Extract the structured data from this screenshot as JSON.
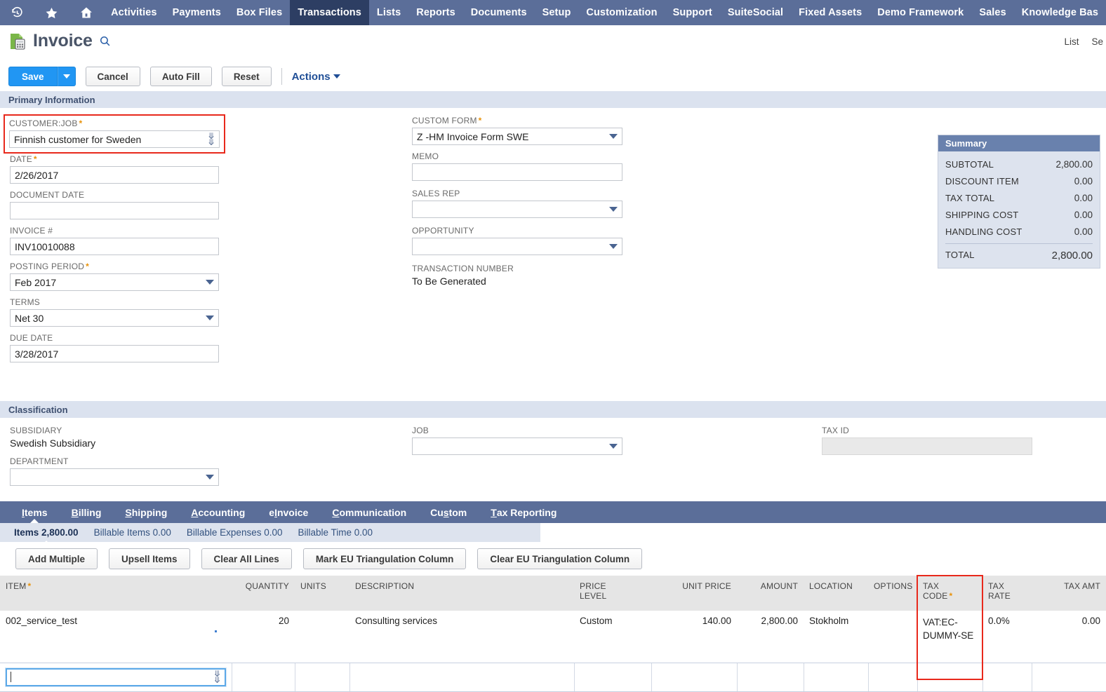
{
  "topnav": {
    "icons": [
      {
        "name": "recent-records-icon",
        "glyph": "↺"
      },
      {
        "name": "favorites-star-icon",
        "glyph": "★"
      },
      {
        "name": "home-icon",
        "glyph": "⌂"
      }
    ],
    "items": [
      {
        "label": "Activities",
        "active": false
      },
      {
        "label": "Payments",
        "active": false
      },
      {
        "label": "Box Files",
        "active": false
      },
      {
        "label": "Transactions",
        "active": true
      },
      {
        "label": "Lists",
        "active": false
      },
      {
        "label": "Reports",
        "active": false
      },
      {
        "label": "Documents",
        "active": false
      },
      {
        "label": "Setup",
        "active": false
      },
      {
        "label": "Customization",
        "active": false
      },
      {
        "label": "Support",
        "active": false
      },
      {
        "label": "SuiteSocial",
        "active": false
      },
      {
        "label": "Fixed Assets",
        "active": false
      },
      {
        "label": "Demo Framework",
        "active": false
      },
      {
        "label": "Sales",
        "active": false
      },
      {
        "label": "Knowledge Bas",
        "active": false
      }
    ]
  },
  "header": {
    "title": "Invoice",
    "right_links": [
      "List",
      "Se"
    ]
  },
  "toolbar": {
    "save_label": "Save",
    "cancel_label": "Cancel",
    "autofill_label": "Auto Fill",
    "reset_label": "Reset",
    "actions_label": "Actions"
  },
  "sections": {
    "primary_information": "Primary Information",
    "classification": "Classification"
  },
  "primary": {
    "customer_job": {
      "label": "CUSTOMER:JOB",
      "required": true,
      "value": "Finnish customer for Sweden",
      "highlighted": true
    },
    "date": {
      "label": "DATE",
      "required": true,
      "value": "2/26/2017"
    },
    "document_date": {
      "label": "DOCUMENT DATE",
      "required": false,
      "value": ""
    },
    "invoice_no": {
      "label": "INVOICE #",
      "required": false,
      "value": "INV10010088"
    },
    "posting_period": {
      "label": "POSTING PERIOD",
      "required": true,
      "value": "Feb 2017"
    },
    "terms": {
      "label": "TERMS",
      "required": false,
      "value": "Net 30"
    },
    "due_date": {
      "label": "DUE DATE",
      "required": false,
      "value": "3/28/2017"
    },
    "custom_form": {
      "label": "CUSTOM FORM",
      "required": true,
      "value": "Z -HM Invoice Form SWE"
    },
    "memo": {
      "label": "MEMO",
      "required": false,
      "value": ""
    },
    "sales_rep": {
      "label": "SALES REP",
      "required": false,
      "value": ""
    },
    "opportunity": {
      "label": "OPPORTUNITY",
      "required": false,
      "value": ""
    },
    "transaction_number": {
      "label": "TRANSACTION NUMBER",
      "value": "To Be Generated"
    }
  },
  "summary": {
    "title": "Summary",
    "rows": [
      {
        "label": "SUBTOTAL",
        "value": "2,800.00"
      },
      {
        "label": "DISCOUNT ITEM",
        "value": "0.00"
      },
      {
        "label": "TAX TOTAL",
        "value": "0.00"
      },
      {
        "label": "SHIPPING COST",
        "value": "0.00"
      },
      {
        "label": "HANDLING COST",
        "value": "0.00"
      }
    ],
    "total": {
      "label": "TOTAL",
      "value": "2,800.00"
    }
  },
  "classification": {
    "subsidiary": {
      "label": "SUBSIDIARY",
      "value": "Swedish Subsidiary"
    },
    "department": {
      "label": "DEPARTMENT",
      "value": ""
    },
    "job": {
      "label": "JOB",
      "value": ""
    },
    "tax_id": {
      "label": "TAX ID",
      "value": "",
      "disabled": true
    }
  },
  "tabs": [
    {
      "label": "Items",
      "accel": 0,
      "active": true
    },
    {
      "label": "Billing",
      "accel": 0,
      "active": false
    },
    {
      "label": "Shipping",
      "accel": 0,
      "active": false
    },
    {
      "label": "Accounting",
      "accel": 0,
      "active": false
    },
    {
      "label": "eInvoice",
      "accel": 1,
      "active": false
    },
    {
      "label": "Communication",
      "accel": 0,
      "active": false
    },
    {
      "label": "Custom",
      "accel": 2,
      "active": false
    },
    {
      "label": "Tax Reporting",
      "accel": 0,
      "active": false
    }
  ],
  "subtabs": [
    {
      "label": "Items 2,800.00",
      "active": true
    },
    {
      "label": "Billable Items 0.00",
      "active": false
    },
    {
      "label": "Billable Expenses 0.00",
      "active": false
    },
    {
      "label": "Billable Time 0.00",
      "active": false
    }
  ],
  "sublist_buttons": [
    {
      "label": "Add Multiple"
    },
    {
      "label": "Upsell Items"
    },
    {
      "label": "Clear All Lines"
    },
    {
      "label": "Mark EU Triangulation Column"
    },
    {
      "label": "Clear EU Triangulation Column"
    }
  ],
  "grid": {
    "columns": [
      {
        "label": "ITEM",
        "required": true,
        "align": "left"
      },
      {
        "label": "QUANTITY",
        "required": false,
        "align": "right"
      },
      {
        "label": "UNITS",
        "required": false,
        "align": "left"
      },
      {
        "label": "DESCRIPTION",
        "required": false,
        "align": "left"
      },
      {
        "label": "PRICE LEVEL",
        "required": false,
        "align": "left"
      },
      {
        "label": "UNIT PRICE",
        "required": false,
        "align": "right"
      },
      {
        "label": "AMOUNT",
        "required": false,
        "align": "right"
      },
      {
        "label": "LOCATION",
        "required": false,
        "align": "left"
      },
      {
        "label": "OPTIONS",
        "required": false,
        "align": "left"
      },
      {
        "label": "TAX CODE",
        "required": true,
        "align": "left",
        "highlighted": true
      },
      {
        "label": "TAX RATE",
        "required": false,
        "align": "left"
      },
      {
        "label": "TAX AMT",
        "required": false,
        "align": "right"
      }
    ],
    "rows": [
      {
        "item": "002_service_test",
        "quantity": "20",
        "units": "",
        "description": "Consulting services",
        "price_level": "Custom",
        "unit_price": "140.00",
        "amount": "2,800.00",
        "location": "Stokholm",
        "options": "",
        "tax_code": "VAT:EC-DUMMY-SE",
        "tax_rate": "0.0%",
        "tax_amt": "0.00"
      }
    ],
    "entry_row": {
      "item_value": "",
      "focused": true
    }
  },
  "colors": {
    "nav_bg": "#5b6e99",
    "nav_active": "#2d3e63",
    "section_bar": "#dbe2ef",
    "summary_head": "#6981ad",
    "summary_body": "#dde3ee",
    "primary_button": "#2196f3",
    "highlight_red": "#e8291c",
    "required_star": "#e8920a"
  }
}
